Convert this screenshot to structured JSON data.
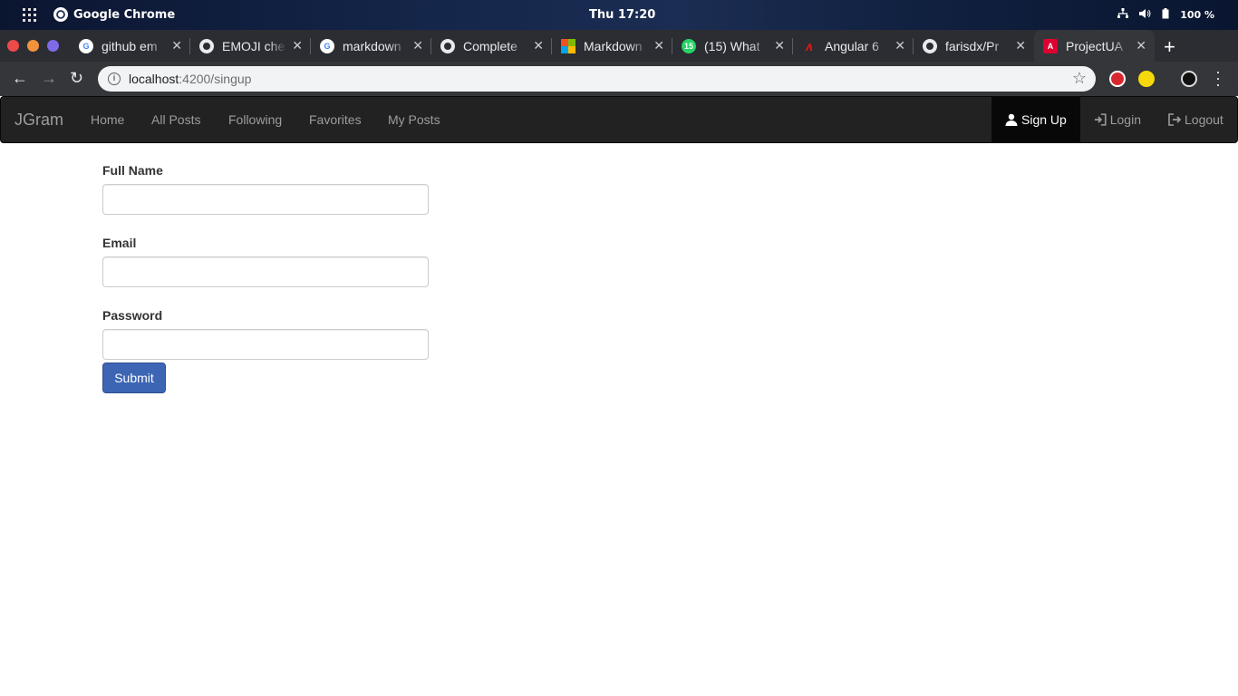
{
  "os": {
    "app_name": "Google Chrome",
    "clock": "Thu 17:20",
    "battery": "100 %"
  },
  "browser": {
    "tabs": [
      {
        "title": "github em",
        "icon": "google-icon",
        "color": "#4285f4"
      },
      {
        "title": "EMOJI che",
        "icon": "github-icon",
        "color": "#3a3b3f"
      },
      {
        "title": "markdown",
        "icon": "google-icon",
        "color": "#4285f4"
      },
      {
        "title": "Complete",
        "icon": "github-icon",
        "color": "#3a3b3f"
      },
      {
        "title": "Markdown",
        "icon": "microsoft-icon",
        "color": "#f25022"
      },
      {
        "title": "(15) What",
        "icon": "whatsapp-icon",
        "color": "#25d366"
      },
      {
        "title": "Angular 6",
        "icon": "angular-university-icon",
        "color": "#dd1b16"
      },
      {
        "title": "farisdx/Pr",
        "icon": "github-icon",
        "color": "#3a3b3f"
      },
      {
        "title": "ProjectUA",
        "icon": "angular-icon",
        "color": "#dd0031",
        "active": true
      }
    ],
    "url_host": "localhost",
    "url_rest": ":4200/singup"
  },
  "app": {
    "brand": "JGram",
    "nav_links": [
      "Home",
      "All Posts",
      "Following",
      "Favorites",
      "My Posts"
    ],
    "signup_label": "Sign Up",
    "login_label": "Login",
    "logout_label": "Logout"
  },
  "form": {
    "full_name_label": "Full Name",
    "full_name_value": "",
    "email_label": "Email",
    "email_value": "",
    "password_label": "Password",
    "password_value": "",
    "submit_label": "Submit"
  },
  "colors": {
    "navbar_bg": "#222222",
    "navbar_active_bg": "#080808",
    "submit_bg": "#3c65b4"
  }
}
